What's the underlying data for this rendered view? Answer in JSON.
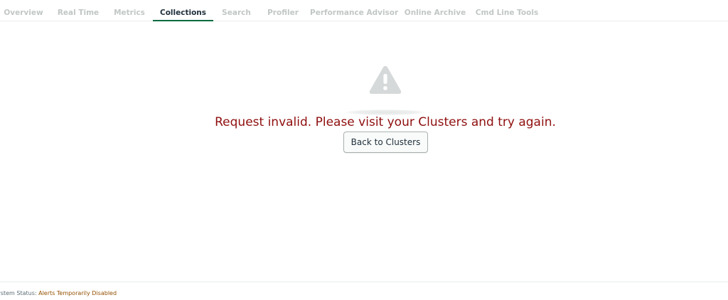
{
  "tabs": [
    {
      "label": "Overview",
      "active": false
    },
    {
      "label": "Real Time",
      "active": false
    },
    {
      "label": "Metrics",
      "active": false
    },
    {
      "label": "Collections",
      "active": true
    },
    {
      "label": "Search",
      "active": false
    },
    {
      "label": "Profiler",
      "active": false
    },
    {
      "label": "Performance Advisor",
      "active": false
    },
    {
      "label": "Online Archive",
      "active": false
    },
    {
      "label": "Cmd Line Tools",
      "active": false
    }
  ],
  "error": {
    "icon": "warning-icon",
    "message": "Request invalid. Please visit your Clusters and try again.",
    "button_label": "Back to Clusters"
  },
  "footer": {
    "status_label": "System Status:",
    "status_value": "Alerts Temporarily Disabled"
  },
  "colors": {
    "accent": "#016b3e",
    "error_text": "#8f0e0e",
    "tab_inactive": "#c1c7c6",
    "tab_active": "#21313c",
    "status_value": "#944f01",
    "icon": "#d6d9d9"
  }
}
